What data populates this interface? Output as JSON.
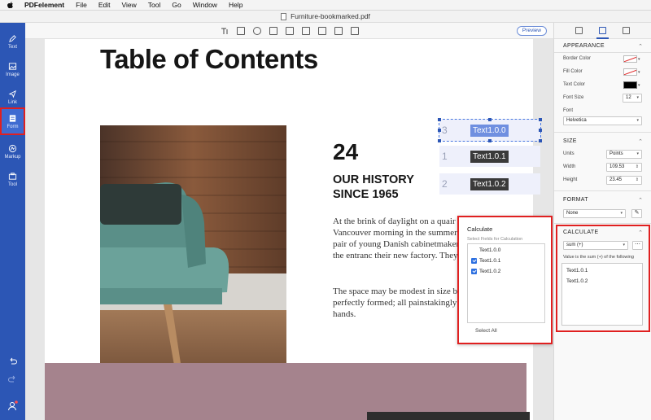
{
  "menubar": {
    "app": "PDFelement",
    "items": [
      "File",
      "Edit",
      "View",
      "Tool",
      "Go",
      "Window",
      "Help"
    ]
  },
  "window": {
    "title": "Furniture-bookmarked.pdf"
  },
  "sidebar": {
    "items": [
      {
        "label": "Text",
        "icon": "pen-icon"
      },
      {
        "label": "Image",
        "icon": "image-icon"
      },
      {
        "label": "Link",
        "icon": "link-icon"
      },
      {
        "label": "Form",
        "icon": "form-icon"
      },
      {
        "label": "Markup",
        "icon": "markup-icon"
      },
      {
        "label": "Tool",
        "icon": "toolbox-icon"
      }
    ],
    "active": "Form"
  },
  "toolbar": {
    "preview_label": "Preview"
  },
  "document": {
    "title": "Table of Contents",
    "number": "24",
    "heading": "OUR HISTORY SINCE 1965",
    "para1": "At the brink of daylight on a quair Vancouver morning in the summer of 1965, a pair of young Danish cabinetmakers stand at the entranc their new factory. They're proud.",
    "para2": "The space may be modest in size bu perfectly formed; all painstakingly by their hands.",
    "fields": [
      {
        "num": "3",
        "name": "Text1.0.0",
        "selected": true
      },
      {
        "num": "1",
        "name": "Text1.0.1",
        "selected": false
      },
      {
        "num": "2",
        "name": "Text1.0.2",
        "selected": false
      }
    ]
  },
  "calc_popup": {
    "title": "Calculate",
    "subtitle": "Select Fields for Calculation",
    "options": [
      {
        "name": "Text1.0.0",
        "checked": false
      },
      {
        "name": "Text1.0.1",
        "checked": true
      },
      {
        "name": "Text1.0.2",
        "checked": true
      }
    ],
    "select_all": "Select All"
  },
  "panel": {
    "appearance": {
      "header": "APPEARANCE",
      "border_color_label": "Border Color",
      "fill_color_label": "Fill Color",
      "text_color_label": "Text Color",
      "font_size_label": "Font Size",
      "font_size": "12",
      "font_label": "Font",
      "font": "Helvetica"
    },
    "size": {
      "header": "SIZE",
      "units_label": "Units",
      "units": "Points",
      "width_label": "Width",
      "width": "109.53",
      "height_label": "Height",
      "height": "23.45"
    },
    "format": {
      "header": "FORMAT",
      "value": "None"
    },
    "calculate": {
      "header": "CALCULATE",
      "operation": "sum (+)",
      "description": "Value is the sum (+) of the following",
      "fields": [
        "Text1.0.1",
        "Text1.0.2"
      ]
    }
  }
}
